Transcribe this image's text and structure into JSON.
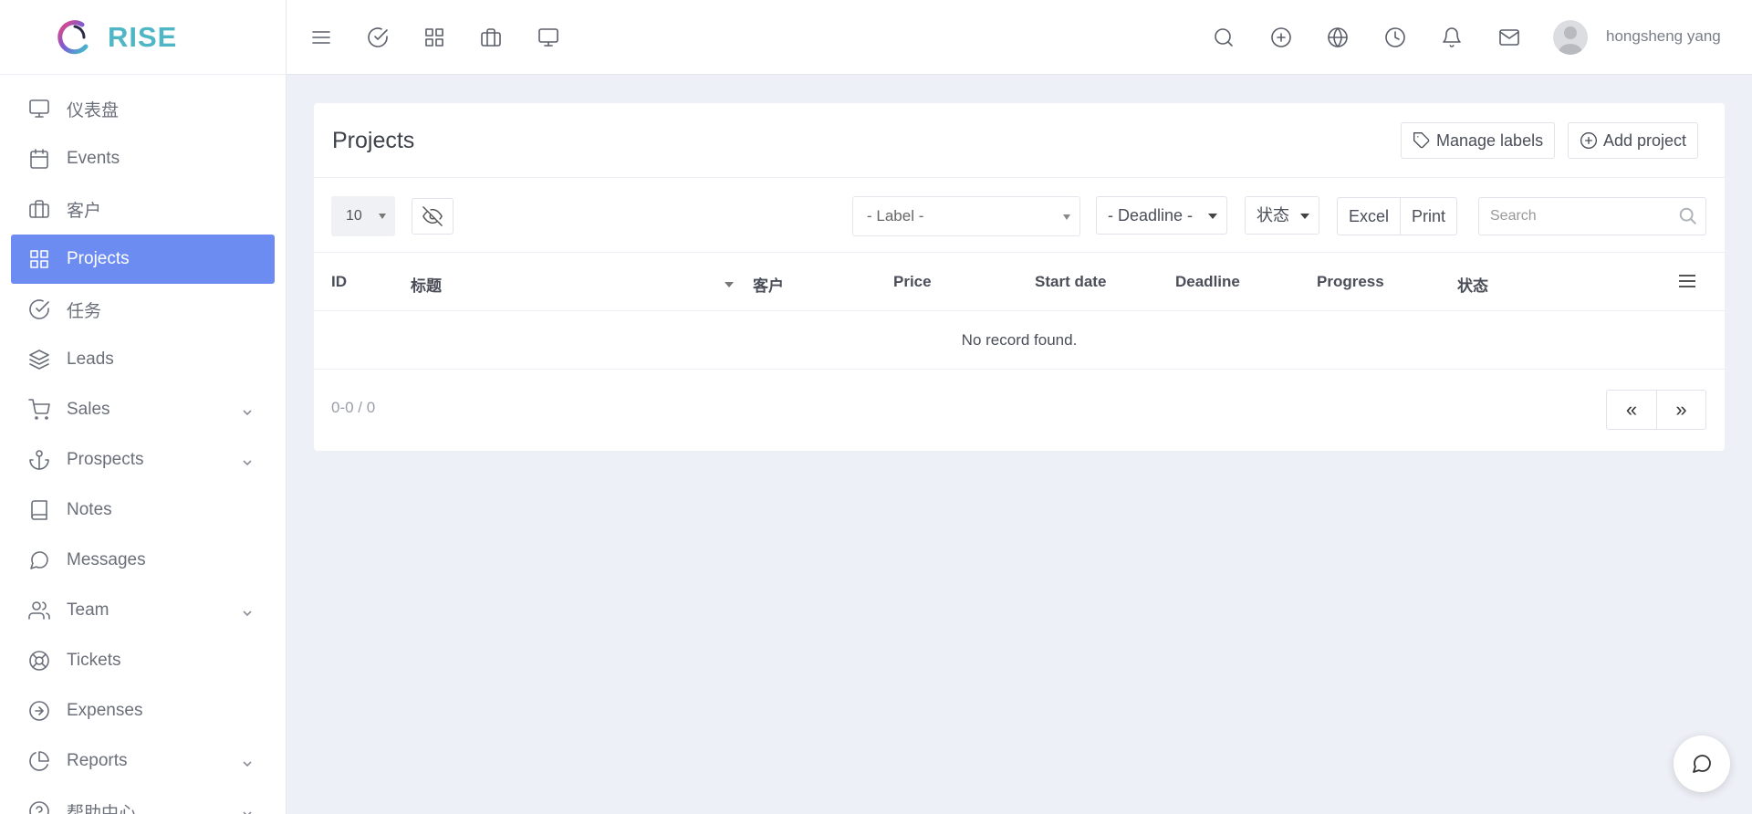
{
  "brand": {
    "name": "RISE",
    "accent": "#4fb6c6"
  },
  "sidebar": {
    "items": [
      {
        "label": "仪表盘",
        "icon": "monitor-icon",
        "active": false,
        "has_submenu": false
      },
      {
        "label": "Events",
        "icon": "calendar-icon",
        "active": false,
        "has_submenu": false
      },
      {
        "label": "客户",
        "icon": "briefcase-icon",
        "active": false,
        "has_submenu": false
      },
      {
        "label": "Projects",
        "icon": "grid-icon",
        "active": true,
        "has_submenu": false
      },
      {
        "label": "任务",
        "icon": "check-circle-icon",
        "active": false,
        "has_submenu": false
      },
      {
        "label": "Leads",
        "icon": "layers-icon",
        "active": false,
        "has_submenu": false
      },
      {
        "label": "Sales",
        "icon": "cart-icon",
        "active": false,
        "has_submenu": true
      },
      {
        "label": "Prospects",
        "icon": "anchor-icon",
        "active": false,
        "has_submenu": true
      },
      {
        "label": "Notes",
        "icon": "book-icon",
        "active": false,
        "has_submenu": false
      },
      {
        "label": "Messages",
        "icon": "message-circle-icon",
        "active": false,
        "has_submenu": false
      },
      {
        "label": "Team",
        "icon": "users-icon",
        "active": false,
        "has_submenu": true
      },
      {
        "label": "Tickets",
        "icon": "life-buoy-icon",
        "active": false,
        "has_submenu": false
      },
      {
        "label": "Expenses",
        "icon": "arrow-right-circle-icon",
        "active": false,
        "has_submenu": false
      },
      {
        "label": "Reports",
        "icon": "pie-chart-icon",
        "active": false,
        "has_submenu": true
      },
      {
        "label": "帮助中心",
        "icon": "help-circle-icon",
        "active": false,
        "has_submenu": true
      }
    ],
    "active_color": "#6d8cf2"
  },
  "topbar": {
    "left_icons": [
      "menu-icon",
      "check-circle-icon",
      "grid-icon",
      "briefcase-icon",
      "monitor-icon"
    ],
    "right_icons": [
      "search-icon",
      "plus-circle-icon",
      "globe-icon",
      "clock-icon",
      "bell-icon",
      "mail-icon"
    ],
    "user_name": "hongsheng yang"
  },
  "page": {
    "title": "Projects",
    "manage_labels": "Manage labels",
    "add_project": "Add project"
  },
  "toolbar": {
    "page_size": "10",
    "label_filter": "- Label -",
    "deadline_filter": "- Deadline -",
    "status_filter": "状态",
    "excel": "Excel",
    "print": "Print",
    "search_placeholder": "Search"
  },
  "table": {
    "columns": [
      "ID",
      "标题",
      "客户",
      "Price",
      "Start date",
      "Deadline",
      "Progress",
      "状态"
    ],
    "empty_message": "No record found.",
    "count_text": "0-0 / 0",
    "prev": "«",
    "next": "»"
  }
}
